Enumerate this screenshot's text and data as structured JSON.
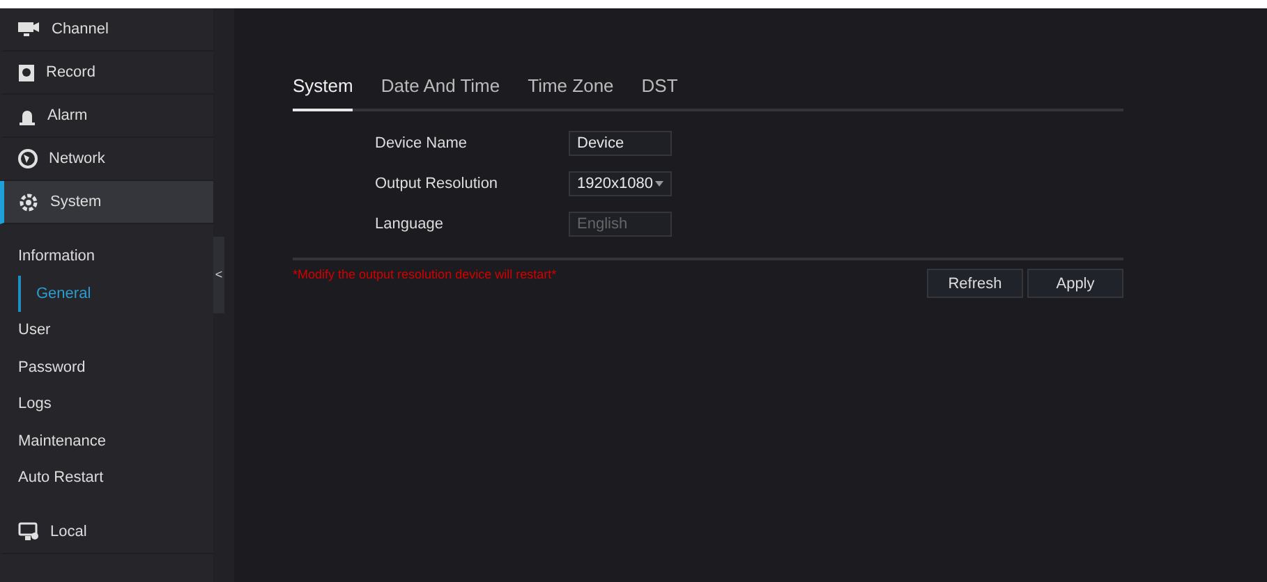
{
  "sidebar": {
    "items": [
      {
        "kind": "main",
        "label": "Channel",
        "selected": false
      },
      {
        "kind": "main",
        "label": "Record",
        "selected": false
      },
      {
        "kind": "main",
        "label": "Alarm",
        "selected": false
      },
      {
        "kind": "main",
        "label": "Network",
        "selected": false
      },
      {
        "kind": "main",
        "label": "System",
        "selected": true
      },
      {
        "kind": "sub",
        "label": "Information",
        "selected": false
      },
      {
        "kind": "sub",
        "label": "General",
        "selected": true
      },
      {
        "kind": "sub",
        "label": "User",
        "selected": false
      },
      {
        "kind": "sub",
        "label": "Password",
        "selected": false
      },
      {
        "kind": "sub",
        "label": "Logs",
        "selected": false
      },
      {
        "kind": "sub",
        "label": "Maintenance",
        "selected": false
      },
      {
        "kind": "sub",
        "label": "Auto Restart",
        "selected": false
      },
      {
        "kind": "main",
        "label": "Local",
        "selected": false
      }
    ]
  },
  "collapse_handle": "<",
  "tabs": [
    {
      "label": "System",
      "selected": true
    },
    {
      "label": "Date And Time",
      "selected": false
    },
    {
      "label": "Time Zone",
      "selected": false
    },
    {
      "label": "DST",
      "selected": false
    }
  ],
  "form": [
    {
      "kind": "text",
      "label": "Device Name",
      "value": "Device",
      "disabled": false
    },
    {
      "kind": "select",
      "label": "Output Resolution",
      "value": "1920x1080",
      "disabled": false
    },
    {
      "kind": "text",
      "label": "Language",
      "value": "English",
      "disabled": true
    }
  ],
  "warning": "*Modify the output resolution device will restart*",
  "buttons": [
    "Refresh",
    "Apply"
  ]
}
